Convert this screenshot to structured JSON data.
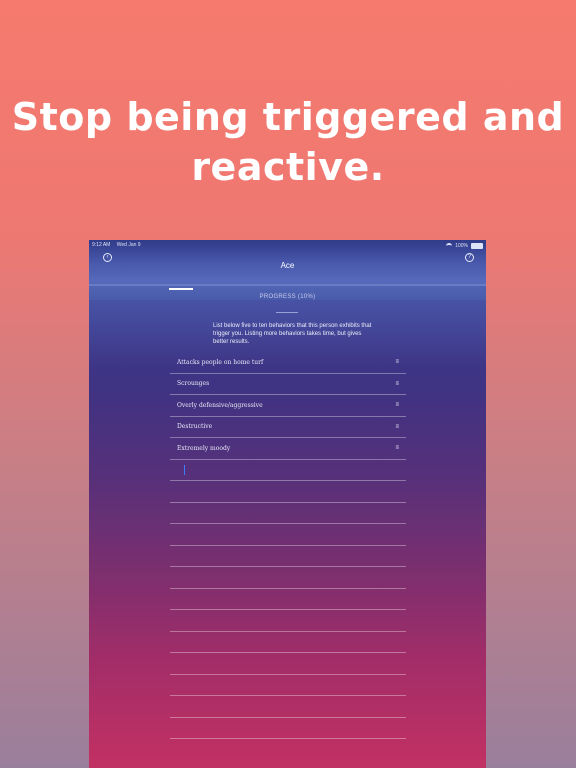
{
  "headline": {
    "line1": "Stop being triggered and",
    "line2": "reactive."
  },
  "device": {
    "status_bar": {
      "time": "9:12 AM",
      "date": "Wed Jan 9",
      "battery": "100%"
    },
    "nav": {
      "title": "Ace",
      "back_icon": "back-chevron-icon",
      "help_icon": "help-icon"
    },
    "progress": {
      "label": "PROGRESS (10%)",
      "value_percent": 10
    },
    "instructions": "List below five to ten behaviors that this person exhibits that trigger you.  Listing more behaviors takes time, but gives better results.",
    "behaviors": [
      "Attacks people on home turf",
      "Scrounges",
      "Overly defensive/aggressive",
      "Destructive",
      "Extremely moody",
      "",
      "",
      "",
      "",
      "",
      "",
      "",
      "",
      "",
      "",
      "",
      "",
      "",
      ""
    ],
    "colors": {
      "accent": "#3c7cff",
      "text": "#ffffff"
    }
  }
}
